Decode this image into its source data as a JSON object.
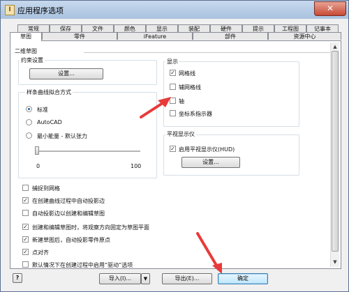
{
  "window": {
    "title": "应用程序选项",
    "app_icon_glyph": "I",
    "close_glyph": "✕"
  },
  "tabs_row1": [
    "常规",
    "保存",
    "文件",
    "颜色",
    "显示",
    "装配",
    "硬件",
    "提示",
    "工程图",
    "记事本"
  ],
  "tabs_row2": [
    "草图",
    "零件",
    "iFeature",
    "部件",
    "资源中心"
  ],
  "active_tab": "草图",
  "sketch": {
    "section_title": "二维草图",
    "constraint": {
      "title": "约束设置",
      "settings_button": "设置..."
    },
    "spline": {
      "title": "样条曲线拟合方式",
      "options": [
        "标准",
        "AutoCAD",
        "最小能量 - 默认张力"
      ],
      "selected": "标准",
      "slider": {
        "min_label": "0",
        "max_label": "100",
        "value": 0
      }
    },
    "display": {
      "title": "显示",
      "items": [
        {
          "label": "网格线",
          "checked": true
        },
        {
          "label": "辅网格线",
          "checked": false
        },
        {
          "label": "轴",
          "checked": false
        },
        {
          "label": "坐标系指示器",
          "checked": false
        }
      ]
    },
    "heads_up": {
      "title": "平视显示仪",
      "enable_label": "启用平视显示仪(HUD)",
      "enabled": true,
      "settings_button": "设置..."
    },
    "options": [
      {
        "label": "捕捉到网格",
        "checked": false
      },
      {
        "label": "在创建曲线过程中自动投影边",
        "checked": true
      },
      {
        "label": "自动投影边以创建和编辑草图",
        "checked": false
      },
      {
        "label": "创建和编辑草图时，将观察方向固定为草图平面",
        "checked": true
      },
      {
        "label": "新建草图后，自动投影零件原点",
        "checked": true
      },
      {
        "label": "点对齐",
        "checked": true
      },
      {
        "label": "默认情况下在创建过程中启用“驱动”选项",
        "checked": false
      }
    ]
  },
  "footer": {
    "help_glyph": "?",
    "import_button": "导入(I)...",
    "export_button": "导出(E)...",
    "ok_button": "确定",
    "check_glyph": "✓"
  },
  "annotation_color": "#e83a3a"
}
